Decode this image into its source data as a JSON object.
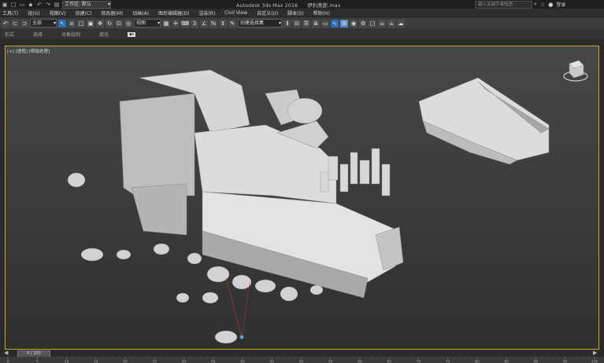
{
  "window": {
    "title": "Autodesk 3ds Max 2016",
    "file": "伊利奥斯.max",
    "workspace_label": "工作区: 默认",
    "search_placeholder": "键入关键字或短语",
    "login": "登录"
  },
  "menu": [
    "工具(T)",
    "组(G)",
    "视图(V)",
    "创建(C)",
    "修改器(M)",
    "动画(A)",
    "图形编辑器(D)",
    "渲染(R)",
    "Civil View",
    "自定义(U)",
    "脚本(S)",
    "帮助(H)"
  ],
  "toolbar": {
    "selection_filter": "全部",
    "ref_coord": "视图",
    "named_selection": "创建选择集"
  },
  "ribbon": [
    "形式",
    "选择",
    "对象绘制",
    "填充"
  ],
  "viewport": {
    "label": "[+] [透视] [明暗处理]",
    "active_border": "#c8a832"
  },
  "timeline": {
    "frame_display": "0 / 100",
    "ticks": [
      "0",
      "5",
      "10",
      "15",
      "20",
      "25",
      "30",
      "35",
      "40",
      "45",
      "50",
      "55",
      "60",
      "65",
      "70",
      "75",
      "80",
      "85",
      "90",
      "95",
      "100"
    ]
  },
  "colors": {
    "accent": "#2d6fb8",
    "viewport_border": "#c8a832"
  }
}
